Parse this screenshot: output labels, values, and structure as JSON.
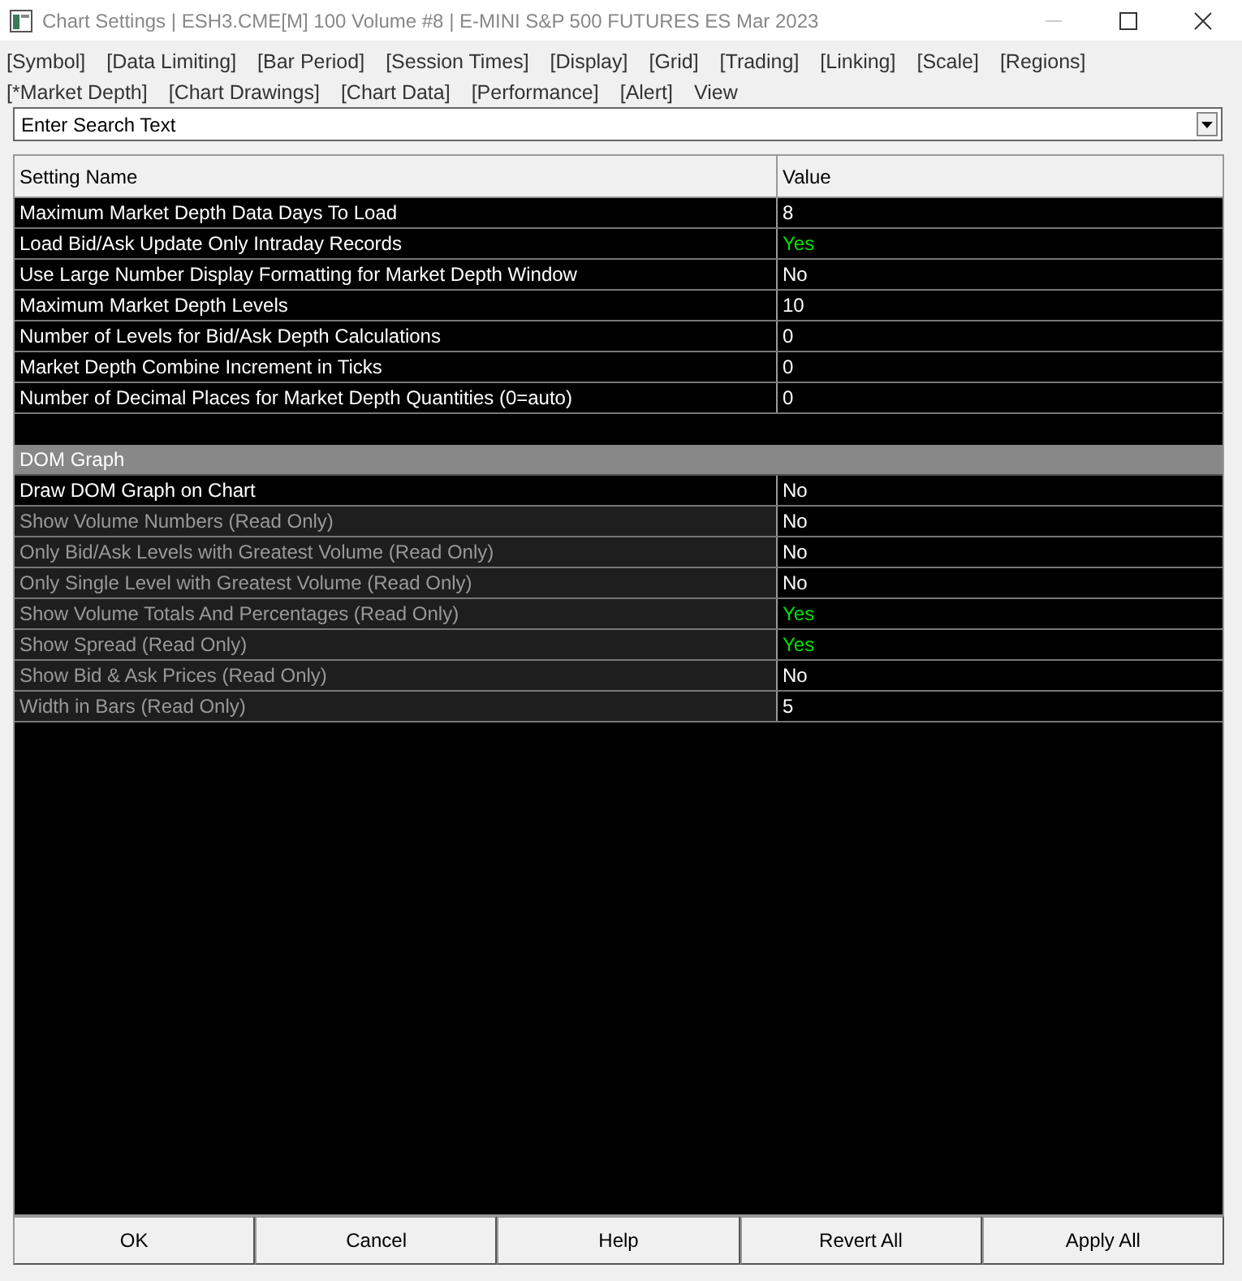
{
  "window": {
    "title": "Chart Settings | ESH3.CME[M]  100 Volume  #8 | E-MINI S&P 500 FUTURES ES Mar 2023"
  },
  "menu_rows": [
    [
      "[Symbol]",
      "[Data Limiting]",
      "[Bar Period]",
      "[Session Times]",
      "[Display]",
      "[Grid]",
      "[Trading]",
      "[Linking]",
      "[Scale]",
      "[Regions]"
    ],
    [
      "[*Market Depth]",
      "[Chart Drawings]",
      "[Chart Data]",
      "[Performance]",
      "[Alert]",
      "View"
    ]
  ],
  "search": {
    "placeholder": "Enter Search Text"
  },
  "table": {
    "columns": [
      "Setting Name",
      "Value"
    ],
    "rows": [
      {
        "kind": "setting",
        "name": "Maximum Market Depth Data Days To Load",
        "value": "8",
        "read_only": false,
        "color": "#ffffff"
      },
      {
        "kind": "setting",
        "name": "Load Bid/Ask Update Only Intraday Records",
        "value": "Yes",
        "read_only": false,
        "color": "#00e000"
      },
      {
        "kind": "setting",
        "name": "Use Large Number Display Formatting for Market Depth Window",
        "value": "No",
        "read_only": false,
        "color": "#ffffff"
      },
      {
        "kind": "setting",
        "name": "Maximum Market Depth Levels",
        "value": "10",
        "read_only": false,
        "color": "#ffffff"
      },
      {
        "kind": "setting",
        "name": "Number of Levels for Bid/Ask Depth Calculations",
        "value": "0",
        "read_only": false,
        "color": "#ffffff"
      },
      {
        "kind": "setting",
        "name": "Market Depth Combine Increment in Ticks",
        "value": "0",
        "read_only": false,
        "color": "#ffffff"
      },
      {
        "kind": "setting",
        "name": "Number of Decimal Places for Market Depth Quantities (0=auto)",
        "value": "0",
        "read_only": false,
        "color": "#ffffff"
      },
      {
        "kind": "blank"
      },
      {
        "kind": "section",
        "name": "DOM Graph"
      },
      {
        "kind": "setting",
        "name": "Draw DOM Graph on Chart",
        "value": "No",
        "read_only": false,
        "color": "#ffffff"
      },
      {
        "kind": "setting",
        "name": "Show Volume Numbers (Read Only)",
        "value": "No",
        "read_only": true,
        "color": "#ffffff"
      },
      {
        "kind": "setting",
        "name": "Only Bid/Ask Levels with Greatest Volume (Read Only)",
        "value": "No",
        "read_only": true,
        "color": "#ffffff"
      },
      {
        "kind": "setting",
        "name": "Only Single Level with Greatest Volume (Read Only)",
        "value": "No",
        "read_only": true,
        "color": "#ffffff"
      },
      {
        "kind": "setting",
        "name": "Show Volume Totals And Percentages (Read Only)",
        "value": "Yes",
        "read_only": true,
        "color": "#00e000"
      },
      {
        "kind": "setting",
        "name": "Show Spread (Read Only)",
        "value": "Yes",
        "read_only": true,
        "color": "#00e000"
      },
      {
        "kind": "setting",
        "name": "Show Bid & Ask Prices (Read Only)",
        "value": "No",
        "read_only": true,
        "color": "#ffffff"
      },
      {
        "kind": "setting",
        "name": "Width in Bars (Read Only)",
        "value": "5",
        "read_only": true,
        "color": "#ffffff"
      }
    ]
  },
  "buttons": [
    "OK",
    "Cancel",
    "Help",
    "Revert All",
    "Apply All"
  ]
}
